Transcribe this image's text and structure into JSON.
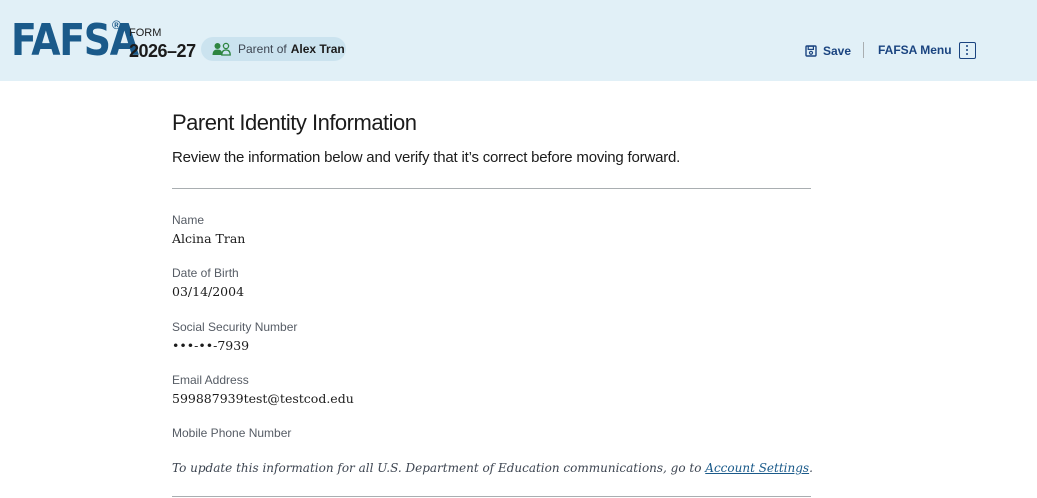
{
  "header": {
    "logo": "FAFSA",
    "registered_mark": "®",
    "form_label": "FORM",
    "form_year": "2026–27",
    "parent_of_label": "Parent of",
    "parent_of_name": "Alex Tran",
    "save_label": "Save",
    "menu_label": "FAFSA Menu",
    "icons": {
      "parent": "parent-user-icon",
      "save": "save-disk-icon",
      "menu": "kebab-menu-icon"
    },
    "colors": {
      "background": "#e1f0f7",
      "brand": "#1a5a8a",
      "link": "#1a4480",
      "pill": "#cbe3ef",
      "parent_icon": "#2e8540"
    }
  },
  "main": {
    "title": "Parent Identity Information",
    "subtitle": "Review the information below and verify that it’s correct before moving forward.",
    "fields": [
      {
        "label": "Name",
        "value": "Alcina Tran"
      },
      {
        "label": "Date of Birth",
        "value": "03/14/2004"
      },
      {
        "label": "Social Security Number",
        "value": "•••-••-7939"
      },
      {
        "label": "Email Address",
        "value": "599887939test@testcod.edu"
      },
      {
        "label": "Mobile Phone Number",
        "value": ""
      }
    ],
    "note": {
      "text": "To update this information for all U.S. Department of Education communications, go to",
      "link_text": "Account Settings",
      "suffix": "."
    }
  }
}
